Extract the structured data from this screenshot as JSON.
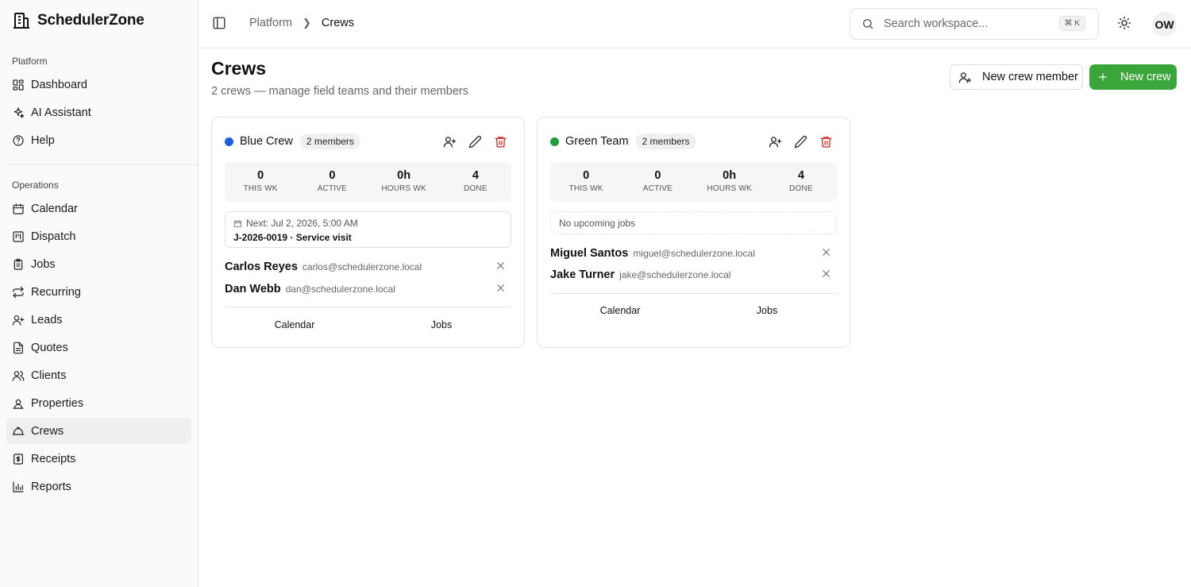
{
  "app": {
    "name": "SchedulerZone"
  },
  "sidebar": {
    "groups": [
      {
        "label": "Platform",
        "items": [
          {
            "label": "Dashboard",
            "icon": "dashboard-icon"
          },
          {
            "label": "AI Assistant",
            "icon": "sparkles-icon"
          },
          {
            "label": "Help",
            "icon": "help-circle-icon"
          }
        ]
      },
      {
        "label": "Operations",
        "items": [
          {
            "label": "Calendar",
            "icon": "calendar-icon"
          },
          {
            "label": "Dispatch",
            "icon": "kanban-icon"
          },
          {
            "label": "Jobs",
            "icon": "clipboard-icon"
          },
          {
            "label": "Recurring",
            "icon": "repeat-icon"
          },
          {
            "label": "Leads",
            "icon": "user-plus-icon"
          },
          {
            "label": "Quotes",
            "icon": "file-text-icon"
          },
          {
            "label": "Clients",
            "icon": "users-icon"
          },
          {
            "label": "Properties",
            "icon": "map-pin-user-icon"
          },
          {
            "label": "Crews",
            "icon": "hard-hat-icon",
            "active": true
          },
          {
            "label": "Receipts",
            "icon": "receipt-icon"
          },
          {
            "label": "Reports",
            "icon": "bar-chart-icon"
          }
        ]
      }
    ]
  },
  "topbar": {
    "breadcrumb": [
      "Platform",
      "Crews"
    ],
    "search_placeholder": "Search workspace...",
    "search_shortcut": "⌘ K",
    "avatar_initials": "OW"
  },
  "page": {
    "title": "Crews",
    "subtitle": "2 crews — manage field teams and their members",
    "new_member_label": "New crew member",
    "new_crew_label": "New crew"
  },
  "crews": [
    {
      "name": "Blue Crew",
      "color": "#1a5fe0",
      "badge": "2 members",
      "stats": [
        {
          "value": "0",
          "label": "THIS WK"
        },
        {
          "value": "0",
          "label": "ACTIVE"
        },
        {
          "value": "0h",
          "label": "HOURS WK"
        },
        {
          "value": "4",
          "label": "DONE"
        }
      ],
      "next_label": "Next: Jul 2, 2026, 5:00 AM",
      "next_job": "J-2026-0019 · Service visit",
      "members": [
        {
          "name": "Carlos Reyes",
          "email": "carlos@schedulerzone.local"
        },
        {
          "name": "Dan Webb",
          "email": "dan@schedulerzone.local"
        }
      ],
      "link_calendar": "Calendar",
      "link_jobs": "Jobs"
    },
    {
      "name": "Green Team",
      "color": "#1e9e3e",
      "badge": "2 members",
      "stats": [
        {
          "value": "0",
          "label": "THIS WK"
        },
        {
          "value": "0",
          "label": "ACTIVE"
        },
        {
          "value": "0h",
          "label": "HOURS WK"
        },
        {
          "value": "4",
          "label": "DONE"
        }
      ],
      "no_jobs": "No upcoming jobs",
      "members": [
        {
          "name": "Miguel Santos",
          "email": "miguel@schedulerzone.local"
        },
        {
          "name": "Jake Turner",
          "email": "jake@schedulerzone.local"
        }
      ],
      "link_calendar": "Calendar",
      "link_jobs": "Jobs"
    }
  ]
}
